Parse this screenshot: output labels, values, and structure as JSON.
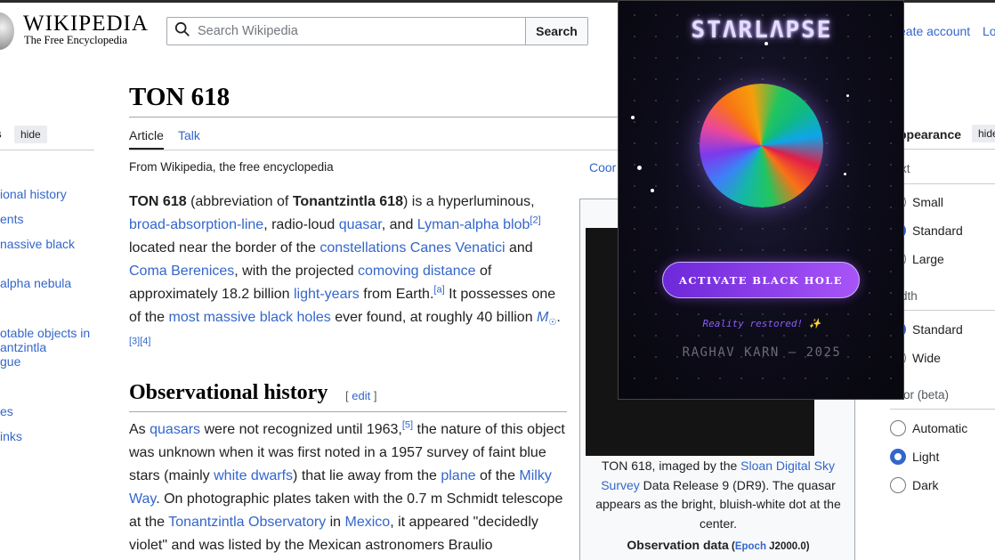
{
  "header": {
    "wordmark": "WIKIPEDIA",
    "tagline": "The Free Encyclopedia",
    "search_placeholder": "Search Wikipedia",
    "search_button": "Search",
    "create_account": "eate account",
    "login": "Lo"
  },
  "toc": {
    "heading": "s",
    "hide": "hide",
    "items": [
      "ional history",
      "ents",
      "nassive black",
      "alpha nebula",
      "otable objects in",
      "antzintla",
      "gue",
      "es",
      "inks"
    ]
  },
  "article": {
    "title": "TON 618",
    "tab_article": "Article",
    "tab_talk": "Talk",
    "from": "From Wikipedia, the free encyclopedia",
    "coordinates": "Coor",
    "p1": {
      "name": "TON 618",
      "t1": " (abbreviation of ",
      "name2": "Tonantzintla 618",
      "t2": ") is a hyperluminous, ",
      "l1": "broad-absorption-line",
      "t3": ", radio-loud ",
      "l2": "quasar",
      "t4": ", and ",
      "l3": "Lyman-alpha blob",
      "r1": "[2]",
      "t5": " located near the border of the ",
      "l4": "constellations",
      "t6": " ",
      "l5": "Canes Venatici",
      "t7": " and ",
      "l6": "Coma Berenices",
      "t8": ", with the projected ",
      "l7": "comoving distance",
      "t9": " of approximately 18.2 billion ",
      "l8": "light-years",
      "t10": " from Earth.",
      "r2": "[a]",
      "t11": " It possesses one of the ",
      "l9": "most massive black holes",
      "t12": " ever found, at roughly 40 billion ",
      "unit": "M",
      "unit_sub": "☉",
      "t13": ".",
      "r3": "[3][4]"
    },
    "h2": "Observational history",
    "h2_edit": "edit",
    "p2": {
      "t1": "As ",
      "l1": "quasars",
      "t2": " were not recognized until 1963,",
      "r1": "[5]",
      "t3": " the nature of this object was unknown when it was first noted in a 1957 survey of faint blue stars (mainly ",
      "l2": "white dwarfs",
      "t4": ") that lie away from the ",
      "l3": "plane",
      "t5": " of the ",
      "l4": "Milky Way",
      "t6": ". On photographic plates taken with the 0.7 m Schmidt telescope at the ",
      "l5": "Tonantzintla Observatory",
      "t7": " in ",
      "l6": "Mexico",
      "t8": ", it appeared \"decidedly violet\" and was listed by the Mexican astronomers Braulio"
    }
  },
  "infobox": {
    "caption_t1": "TON 618, imaged by the ",
    "caption_l1": "Sloan Digital Sky Survey",
    "caption_t2": " Data Release 9 (DR9). The quasar appears as the bright, bluish-white dot at the center.",
    "obs_label": "Observation data",
    "obs_open": " (",
    "obs_epoch": "Epoch",
    "obs_rest": " J2000.0)"
  },
  "appearance": {
    "heading": "ppearance",
    "hide": "hide",
    "text_label": "xt",
    "text_options": [
      "Small",
      "Standard",
      "Large"
    ],
    "text_selected": "Standard",
    "width_label": "dth",
    "width_options": [
      "Standard",
      "Wide"
    ],
    "color_label": "lor (beta)",
    "color_options": [
      "Automatic",
      "Light",
      "Dark"
    ],
    "color_selected": "Light"
  },
  "overlay": {
    "title": "STΛRLΛPSE",
    "button": "ACTIVATE BLACK HOLE",
    "status": "Reality restored! ✨",
    "credit": "RAGHAV KARN — 2025"
  }
}
